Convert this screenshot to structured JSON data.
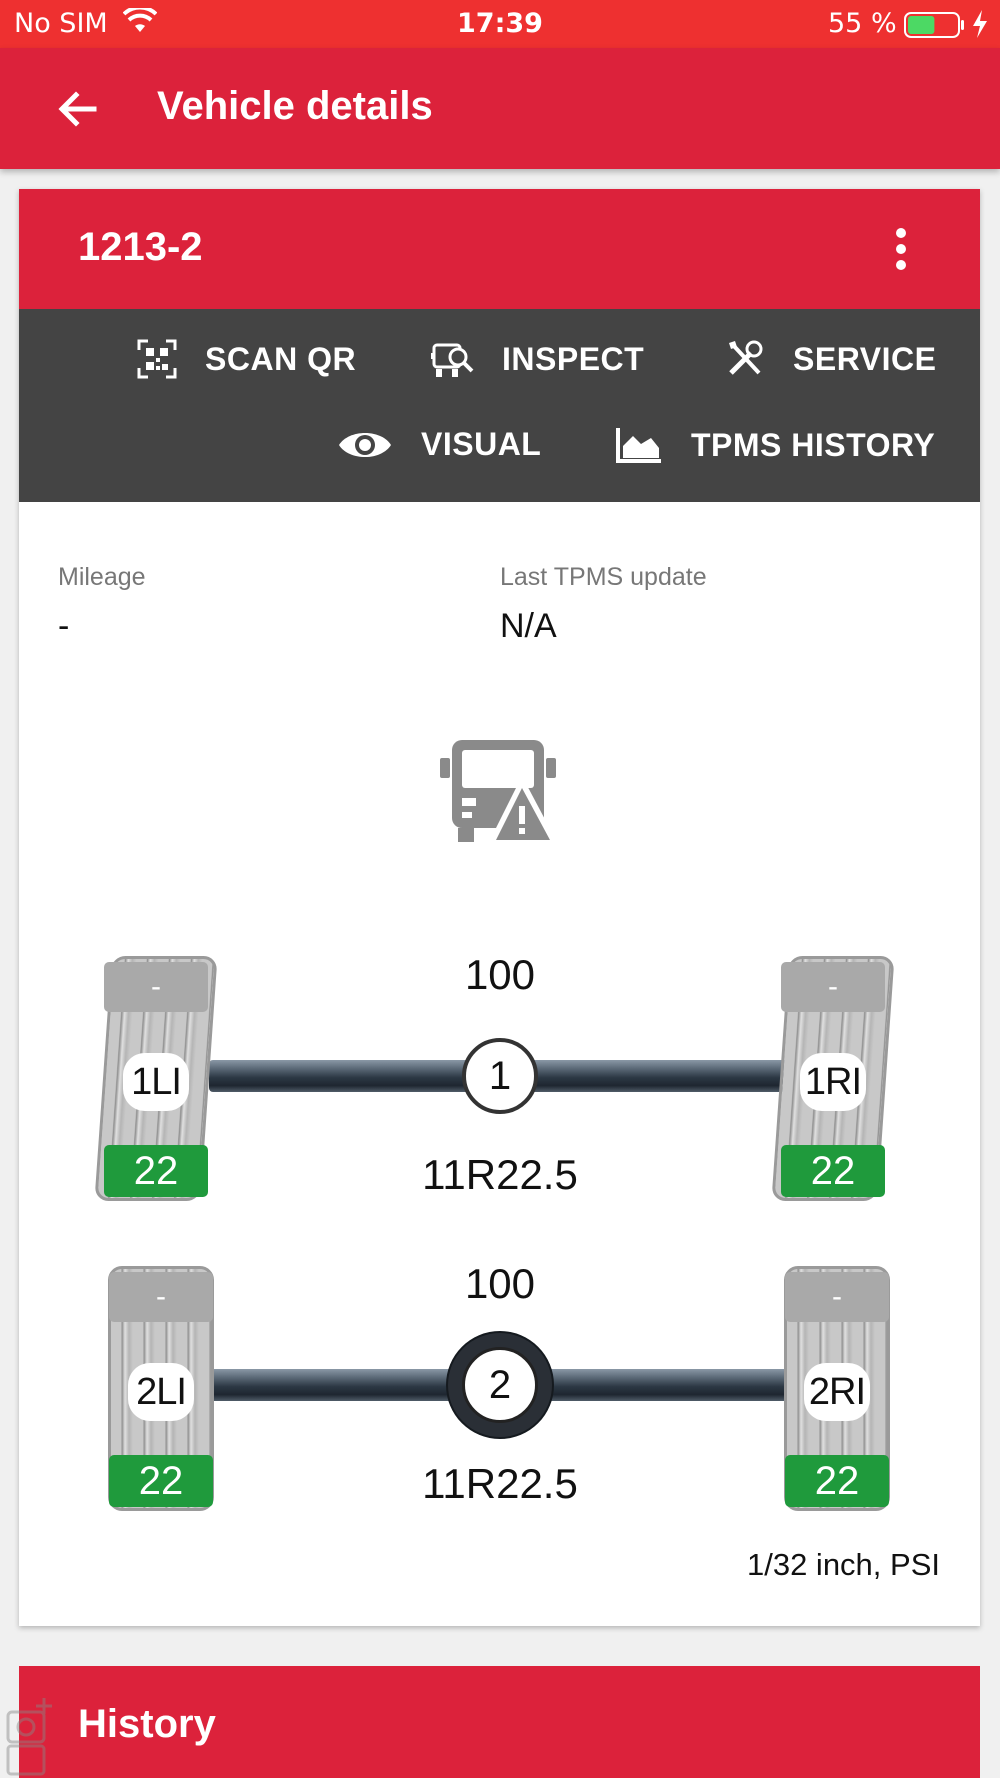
{
  "status_bar": {
    "carrier": "No SIM",
    "time": "17:39",
    "battery_percent": "55 %",
    "battery_level": 0.55
  },
  "app_bar": {
    "title": "Vehicle details"
  },
  "vehicle": {
    "id": "1213-2",
    "actions": {
      "scan_qr": "SCAN QR",
      "inspect": "INSPECT",
      "service": "SERVICE",
      "visual": "VISUAL",
      "tpms_history": "TPMS HISTORY"
    },
    "info": {
      "mileage_label": "Mileage",
      "mileage_value": "-",
      "tpms_label": "Last TPMS update",
      "tpms_value": "N/A"
    },
    "axles": [
      {
        "number": "1",
        "top_value": "100",
        "tire_size": "11R22.5",
        "left_tire": {
          "position": "1LI",
          "pressure": "-",
          "tread_depth": "22"
        },
        "right_tire": {
          "position": "1RI",
          "pressure": "-",
          "tread_depth": "22"
        }
      },
      {
        "number": "2",
        "top_value": "100",
        "tire_size": "11R22.5",
        "left_tire": {
          "position": "2LI",
          "pressure": "-",
          "tread_depth": "22"
        },
        "right_tire": {
          "position": "2RI",
          "pressure": "-",
          "tread_depth": "22"
        }
      }
    ],
    "units": "1/32 inch, PSI"
  },
  "history": {
    "title": "History"
  },
  "colors": {
    "status_bar": "#ee3030",
    "brand_red": "#dc223b",
    "action_bar": "#444444",
    "tread_ok_green": "#1f9a3c",
    "pressure_grey": "#a9a9a9"
  }
}
